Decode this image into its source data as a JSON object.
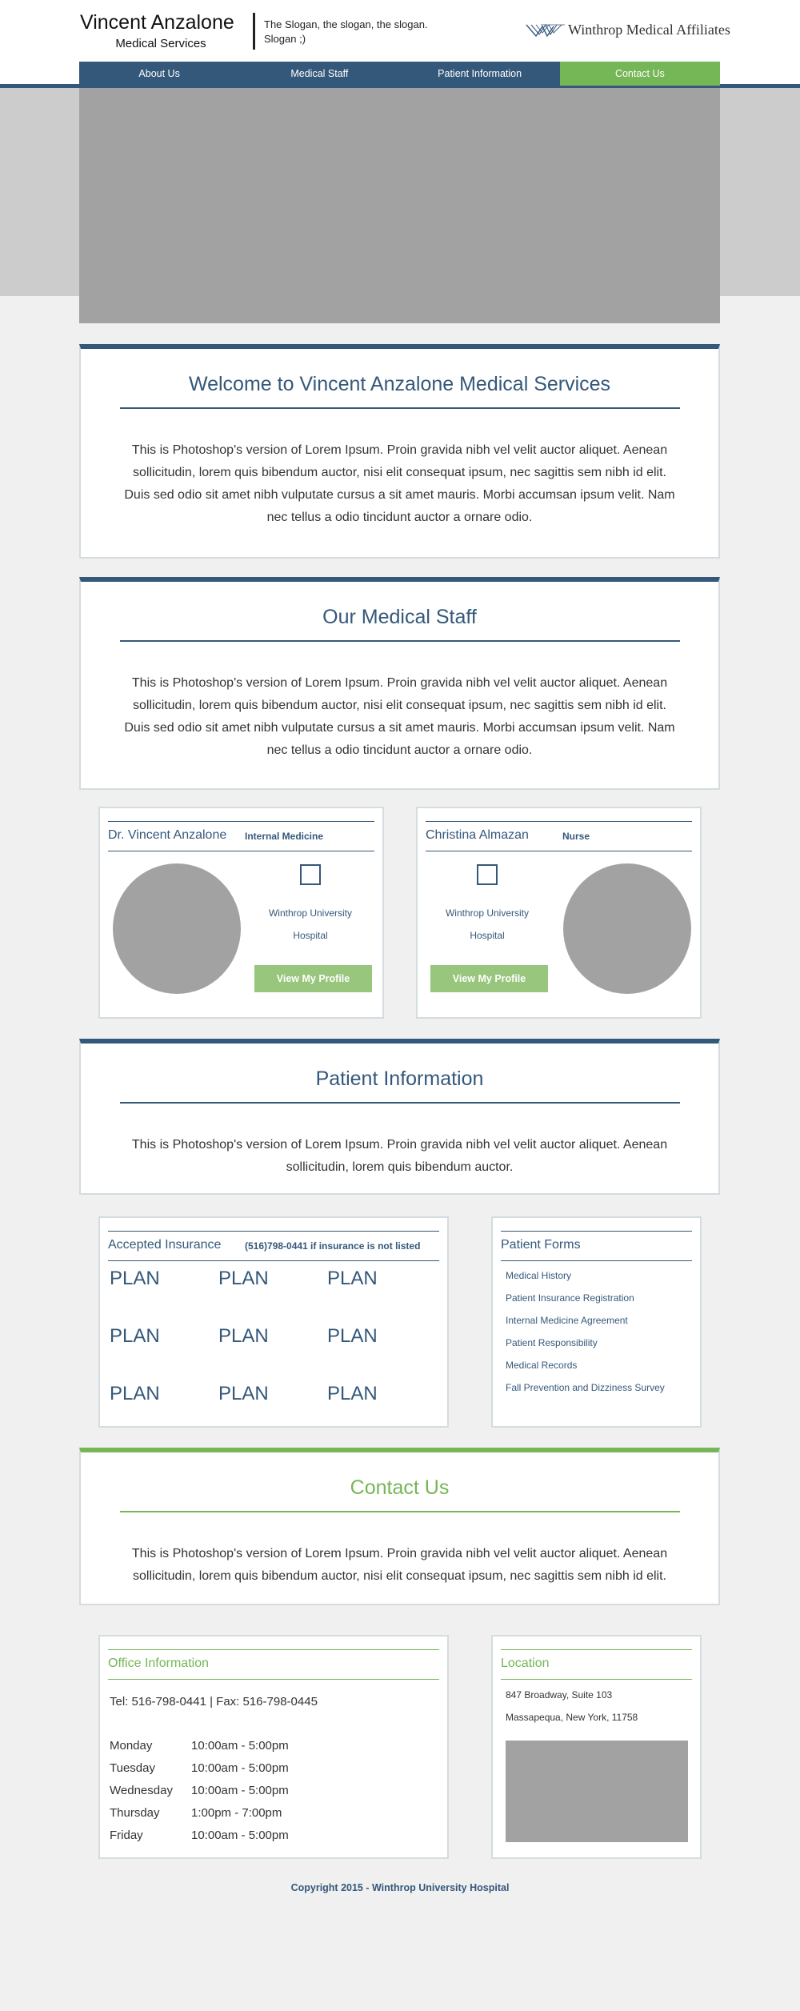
{
  "header": {
    "brand_name": "Vincent Anzalone",
    "brand_sub": "Medical Services",
    "slogan": "The Slogan, the slogan, the slogan. Slogan ;)",
    "logo_text": "Winthrop Medical Affiliates"
  },
  "nav": {
    "items": [
      {
        "label": "About Us"
      },
      {
        "label": "Medical Staff"
      },
      {
        "label": "Patient Information"
      },
      {
        "label": "Contact Us"
      }
    ],
    "active_index": 3
  },
  "welcome": {
    "title": "Welcome to Vincent Anzalone Medical Services",
    "body": "This is Photoshop's version  of Lorem Ipsum. Proin gravida nibh vel velit auctor aliquet. Aenean sollicitudin, lorem quis bibendum auctor, nisi elit consequat ipsum, nec sagittis sem nibh id elit. Duis sed odio sit amet nibh vulputate cursus a sit amet mauris. Morbi accumsan ipsum velit. Nam nec tellus a odio tincidunt auctor a ornare odio."
  },
  "staff": {
    "title": "Our Medical Staff",
    "body": "This is Photoshop's version  of Lorem Ipsum. Proin gravida nibh vel velit auctor aliquet. Aenean sollicitudin, lorem quis bibendum auctor, nisi elit consequat ipsum, nec sagittis sem nibh id elit. Duis sed odio sit amet nibh vulputate cursus a sit amet mauris. Morbi accumsan ipsum velit. Nam nec tellus a odio tincidunt auctor a ornare odio.",
    "members": [
      {
        "name": "Dr. Vincent Anzalone",
        "role": "Internal Medicine",
        "hospital_line1": "Winthrop University",
        "hospital_line2": "Hospital",
        "button": "View My Profile"
      },
      {
        "name": "Christina Almazan",
        "role": "Nurse",
        "hospital_line1": "Winthrop University",
        "hospital_line2": "Hospital",
        "button": "View My Profile"
      }
    ]
  },
  "patient_info": {
    "title": "Patient Information",
    "body": "This is Photoshop's version  of Lorem Ipsum. Proin gravida nibh vel velit auctor aliquet. Aenean sollicitudin, lorem quis bibendum auctor."
  },
  "insurance": {
    "title": "Accepted Insurance",
    "note": "(516)798-0441 if insurance is not listed",
    "plans": [
      "PLAN",
      "PLAN",
      "PLAN",
      "PLAN",
      "PLAN",
      "PLAN",
      "PLAN",
      "PLAN",
      "PLAN"
    ]
  },
  "forms": {
    "title": "Patient Forms",
    "items": [
      "Medical History",
      "Patient Insurance Registration",
      "Internal Medicine Agreement",
      "Patient Responsibility",
      "Medical Records",
      "Fall Prevention and Dizziness Survey"
    ]
  },
  "contact": {
    "title": "Contact Us",
    "body": "This is Photoshop's version  of Lorem Ipsum. Proin gravida nibh vel velit auctor aliquet. Aenean sollicitudin, lorem quis bibendum auctor, nisi elit consequat ipsum, nec sagittis sem nibh id elit."
  },
  "office": {
    "title": "Office Information",
    "tel": "Tel: 516-798-0441 | Fax: 516-798-0445",
    "hours": [
      {
        "day": "Monday",
        "time": "10:00am - 5:00pm"
      },
      {
        "day": "Tuesday",
        "time": "10:00am - 5:00pm"
      },
      {
        "day": "Wednesday",
        "time": "10:00am - 5:00pm"
      },
      {
        "day": "Thursday",
        "time": "1:00pm - 7:00pm"
      },
      {
        "day": "Friday",
        "time": "10:00am - 5:00pm"
      }
    ]
  },
  "location": {
    "title": "Location",
    "address_line1": "847 Broadway, Suite 103",
    "address_line2": "Massapequa, New York, 11758"
  },
  "footer": {
    "copyright": "Copyright 2015 - Winthrop University Hospital"
  },
  "colors": {
    "navy": "#34587a",
    "green": "#75b656",
    "button_green": "#97c67c",
    "placeholder_gray": "#a2a2a2",
    "page_bg": "#f0f0f0"
  }
}
